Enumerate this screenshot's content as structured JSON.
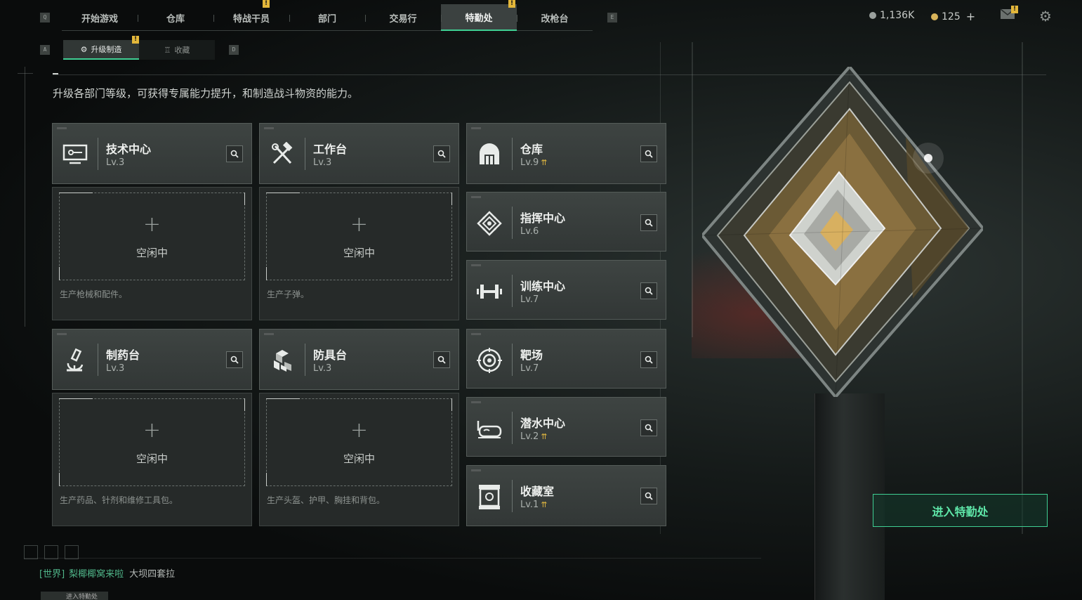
{
  "nav": {
    "left_key": "Q",
    "right_key": "E",
    "tabs": [
      {
        "label": "开始游戏",
        "badge": ""
      },
      {
        "label": "仓库",
        "badge": ""
      },
      {
        "label": "特战干员",
        "badge": "!"
      },
      {
        "label": "部门",
        "badge": ""
      },
      {
        "label": "交易行",
        "badge": ""
      },
      {
        "label": "特勤处",
        "badge": "!",
        "active": true
      },
      {
        "label": "改枪台",
        "badge": ""
      }
    ]
  },
  "subnav": {
    "left_key": "A",
    "right_key": "D",
    "tabs": [
      {
        "label": "升级制造",
        "badge": "!",
        "active": true
      },
      {
        "label": "收藏",
        "badge": ""
      }
    ]
  },
  "status": {
    "currency1": "1,136K",
    "currency2": "125",
    "plus": "+",
    "mail_badge": "!"
  },
  "description": "升级各部门等级，可获得专属能力提升，和制造战斗物资的能力。",
  "workshops": [
    {
      "name": "技术中心",
      "level": "Lv.3",
      "icon": "monitor-icon",
      "slot_label": "空闲中",
      "note": "生产枪械和配件。"
    },
    {
      "name": "工作台",
      "level": "Lv.3",
      "icon": "hammer-wrench-icon",
      "slot_label": "空闲中",
      "note": "生产子弹。"
    },
    {
      "name": "制药台",
      "level": "Lv.3",
      "icon": "microscope-icon",
      "slot_label": "空闲中",
      "note": "生产药品、针剂和维修工具包。"
    },
    {
      "name": "防具台",
      "level": "Lv.3",
      "icon": "cubes-icon",
      "slot_label": "空闲中",
      "note": "生产头盔、护甲、胸挂和背包。"
    }
  ],
  "departments": [
    {
      "name": "仓库",
      "level": "Lv.9",
      "upgradable": true,
      "icon": "vault-icon"
    },
    {
      "name": "指挥中心",
      "level": "Lv.6",
      "upgradable": false,
      "icon": "command-icon"
    },
    {
      "name": "训练中心",
      "level": "Lv.7",
      "upgradable": false,
      "icon": "dumbbell-icon"
    },
    {
      "name": "靶场",
      "level": "Lv.7",
      "upgradable": false,
      "icon": "target-icon"
    },
    {
      "name": "潜水中心",
      "level": "Lv.2",
      "upgradable": true,
      "icon": "diving-mask-icon"
    },
    {
      "name": "收藏室",
      "level": "Lv.1",
      "upgradable": true,
      "icon": "collection-icon"
    }
  ],
  "enter_button": "进入特勤处",
  "chat": {
    "channel": "[世界]",
    "sender": "梨椰椰窝来啦",
    "message": "大坝四套拉"
  },
  "bottom_button": "进入特勤处",
  "colors": {
    "accent": "#3fcf93",
    "badge": "#e3b73a",
    "upgrade": "#e0b640"
  }
}
